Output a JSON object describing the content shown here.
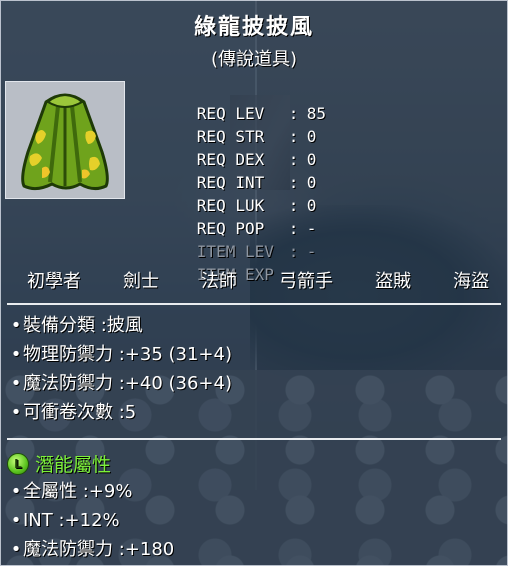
{
  "item": {
    "name": "綠龍披披風",
    "rarity": "(傳說道具)"
  },
  "requirements": [
    {
      "label": "REQ LEV",
      "value": "85",
      "dim": false
    },
    {
      "label": "REQ STR",
      "value": "0",
      "dim": false
    },
    {
      "label": "REQ DEX",
      "value": "0",
      "dim": false
    },
    {
      "label": "REQ INT",
      "value": "0",
      "dim": false
    },
    {
      "label": "REQ LUK",
      "value": "0",
      "dim": false
    },
    {
      "label": "REQ POP",
      "value": "-",
      "dim": false
    },
    {
      "label": "ITEM LEV",
      "value": "-",
      "dim": true
    },
    {
      "label": "ITEM EXP",
      "value": "-",
      "dim": true
    }
  ],
  "jobs": [
    "初學者",
    "劍士",
    "法師",
    "弓箭手",
    "盜賊",
    "海盜"
  ],
  "stats": [
    "裝備分類 :披風",
    "物理防禦力 :+35 (31+4)",
    "魔法防禦力 :+40 (36+4)",
    "可衝卷次數 :5"
  ],
  "potential": {
    "icon_letter": "L",
    "title": "潛能屬性",
    "lines": [
      "全屬性 :+9%",
      "INT :+12%",
      "魔法防禦力 :+180"
    ]
  },
  "colors": {
    "potential_green": "#7cf03a",
    "dim_text": "#8d95a0"
  }
}
